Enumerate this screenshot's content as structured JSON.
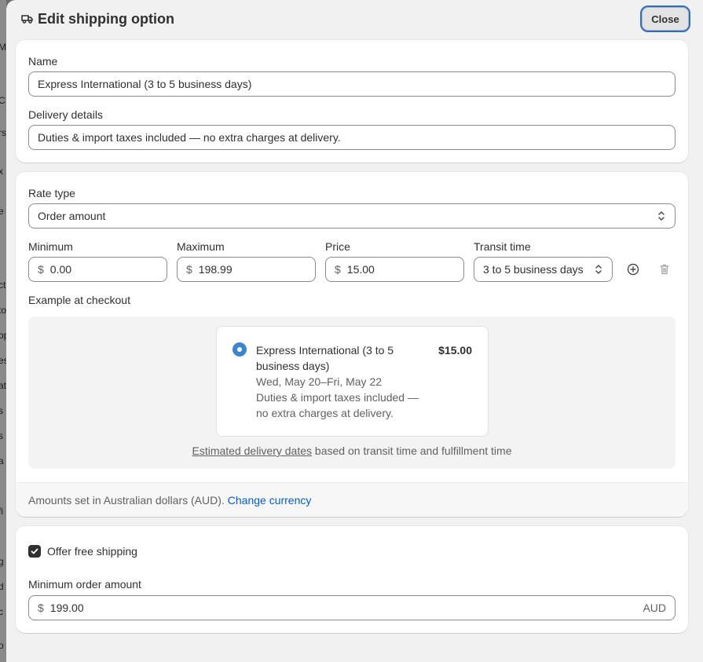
{
  "header": {
    "title": "Edit shipping option",
    "icon": "truck-icon",
    "close_label": "Close"
  },
  "backdrop": {
    "fragments": [
      "M",
      "C",
      "rs",
      "x",
      "e",
      "ct",
      "to",
      "op",
      "es",
      "at",
      "s",
      "s",
      "a",
      "fi",
      "g",
      "d",
      "c",
      "o"
    ]
  },
  "basics": {
    "name_label": "Name",
    "name_value": "Express International (3 to 5 business days)",
    "details_label": "Delivery details",
    "details_value": "Duties & import taxes included — no extra charges at delivery."
  },
  "rates": {
    "rate_type_label": "Rate type",
    "rate_type_value": "Order amount",
    "minimum_label": "Minimum",
    "minimum_value": "0.00",
    "maximum_label": "Maximum",
    "maximum_value": "198.99",
    "price_label": "Price",
    "price_value": "15.00",
    "currency_symbol": "$",
    "transit_label": "Transit time",
    "transit_value": "3 to 5 business days",
    "example_label": "Example at checkout",
    "preview": {
      "name": "Express International (3 to 5 business days)",
      "dates": "Wed, May 20–Fri, May 22",
      "details": "Duties & import taxes included — no extra charges at delivery.",
      "price": "$15.00"
    },
    "footnote_link": "Estimated delivery dates",
    "footnote_rest": " based on transit time and fulfillment time",
    "currency_text": "Amounts set in Australian dollars (AUD).",
    "currency_link": "Change currency"
  },
  "free_shipping": {
    "checkbox_label": "Offer free shipping",
    "checked": true,
    "min_label": "Minimum order amount",
    "min_value": "199.00",
    "currency_code": "AUD"
  },
  "colors": {
    "accent": "#2c6ecb",
    "link": "#005bd3",
    "radio": "#3b84d0"
  }
}
